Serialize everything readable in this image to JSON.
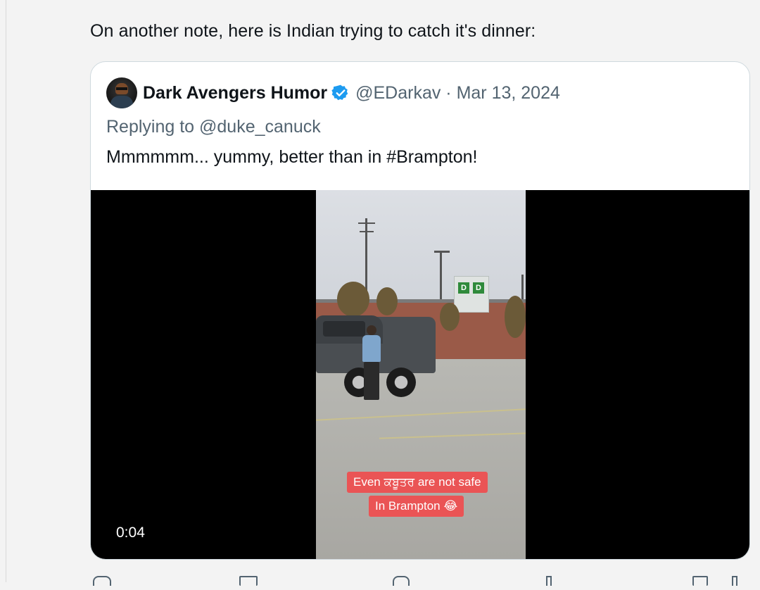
{
  "post": {
    "text": "On another note, here is Indian trying to catch it's dinner:"
  },
  "quote": {
    "author_name": "Dark Avengers Humor",
    "verified": true,
    "handle_date": "@EDarkav · Mar 13, 2024",
    "replying_to": "Replying to @duke_canuck",
    "body": "Mmmmmm... yummy, better than in #Brampton!",
    "video": {
      "caption_line1": "Even ਕਬੂਤਰ are not safe",
      "caption_line2": "In Brampton 😂",
      "timestamp": "0:04"
    }
  },
  "colors": {
    "accent": "#1d9bf0",
    "text": "#0f1419",
    "secondary_text": "#536471",
    "caption_bg": "#ea5455"
  },
  "icons": [
    "verified-badge-icon",
    "reply-icon",
    "repost-icon",
    "like-icon",
    "views-icon",
    "bookmark-icon",
    "share-icon"
  ]
}
